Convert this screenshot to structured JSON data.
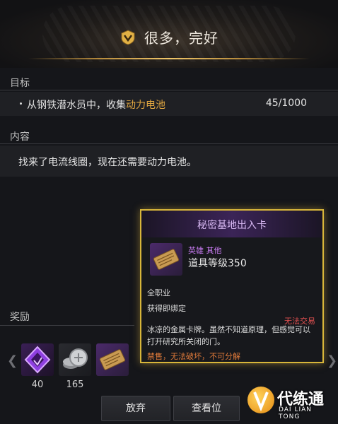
{
  "header": {
    "title": "很多，完好"
  },
  "objective": {
    "heading": "目标",
    "text_prefix": "从钢铁潜水员中，收集",
    "text_highlight": "动力电池",
    "progress": "45/1000"
  },
  "content": {
    "heading": "内容",
    "text": "找来了电流线圈，现在还需要动力电池。"
  },
  "rewards": {
    "heading": "奖励",
    "items": [
      {
        "icon": "purple-crystal-icon",
        "count": "40"
      },
      {
        "icon": "silver-coins-icon",
        "count": "165"
      },
      {
        "icon": "gold-card-icon",
        "count": ""
      }
    ]
  },
  "buttons": {
    "abandon": "放弃",
    "view": "查看位"
  },
  "tooltip": {
    "title": "秘密基地出入卡",
    "rarity": "英雄 其他",
    "item_level": "道具等级350",
    "class": "全职业",
    "bind": "获得即绑定",
    "trade": "无法交易",
    "description": "冰凉的金属卡牌。虽然不知道原理，但感觉可以打开研究所关闭的门。",
    "warning": "禁售，无法破坏，不可分解"
  },
  "watermark": {
    "cn": "代练通",
    "en": "DAI LIAN TONG"
  },
  "colors": {
    "highlight": "#e0a640",
    "tooltip_border": "#d8b63a",
    "hero_purple": "#c77bf0",
    "warning_red": "#e05050"
  }
}
